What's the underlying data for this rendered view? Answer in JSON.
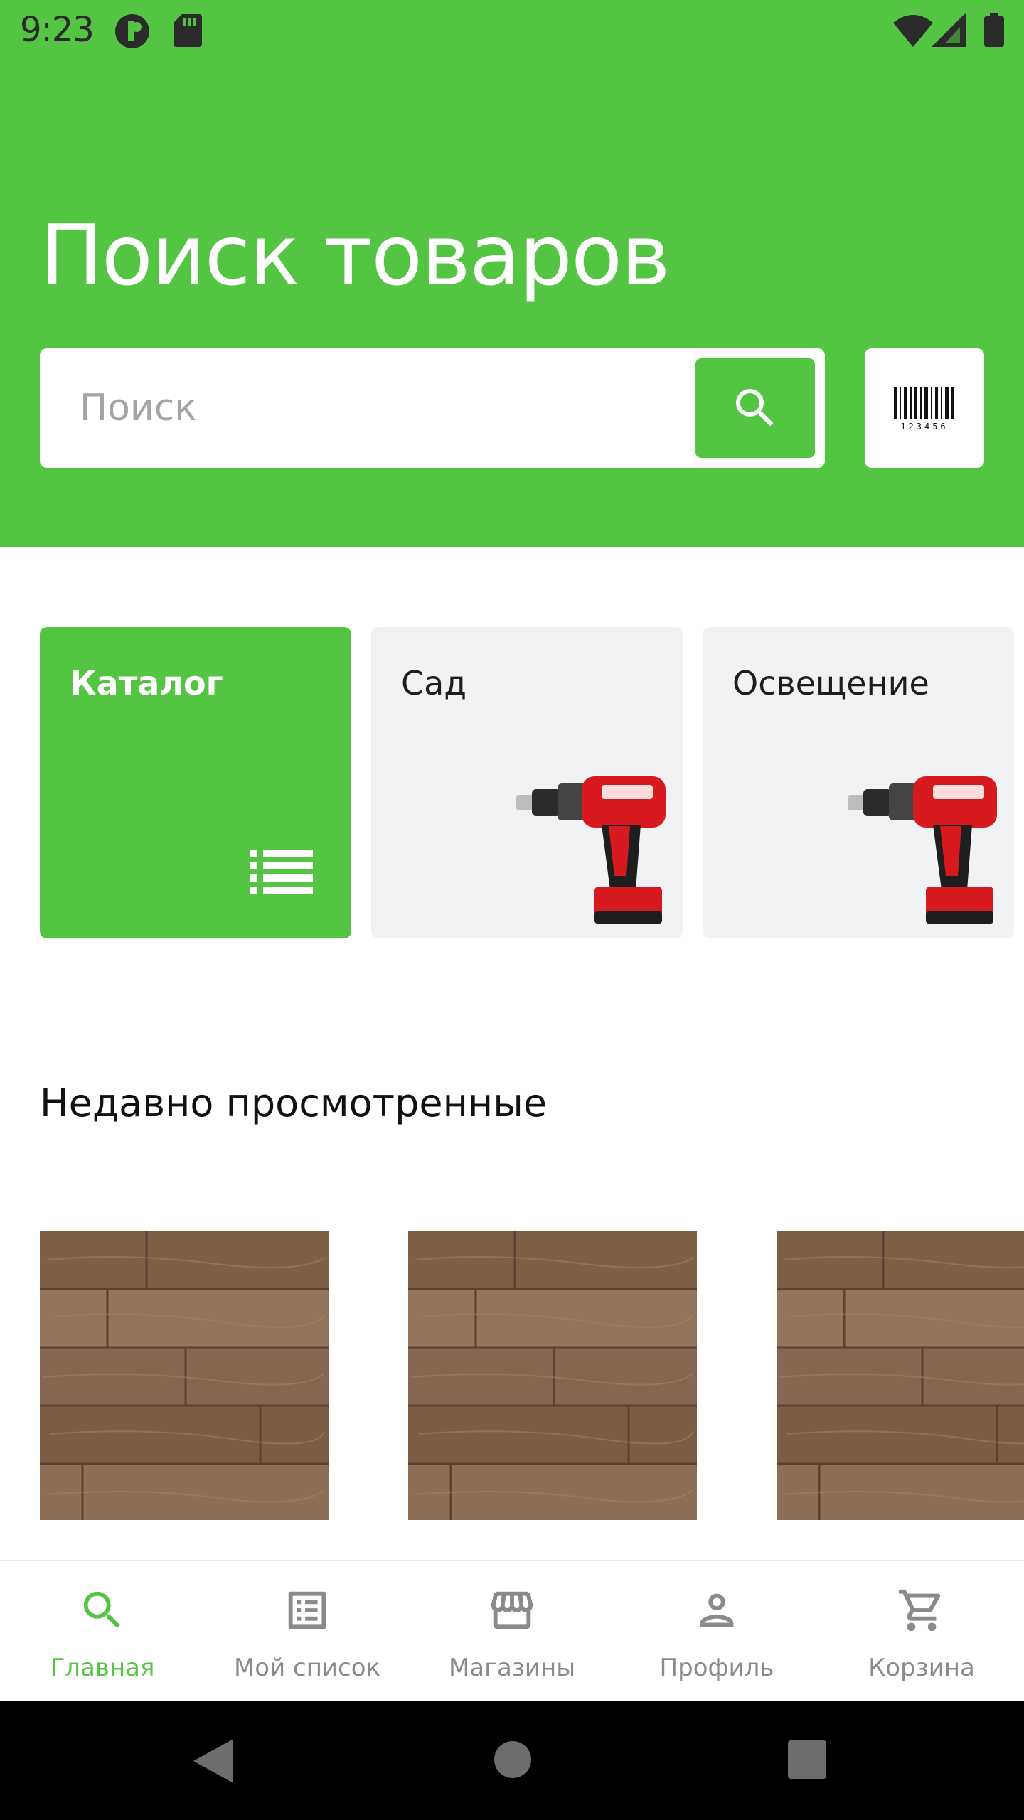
{
  "status_bar": {
    "time": "9:23",
    "icons": [
      "app-notification-icon",
      "sd-card-icon",
      "wifi-icon",
      "signal-icon",
      "battery-icon"
    ]
  },
  "header": {
    "title": "Поиск товаров",
    "background_color": "#54c443"
  },
  "search": {
    "placeholder": "Поиск",
    "value": "",
    "search_button_icon": "search-icon",
    "barcode_button_icon": "barcode-icon",
    "barcode_digits": "123456"
  },
  "categories": [
    {
      "label": "Каталог",
      "icon": "list-icon"
    },
    {
      "label": "Сад",
      "icon": "drill-image"
    },
    {
      "label": "Освещение",
      "icon": "drill-image"
    }
  ],
  "recent": {
    "title": "Недавно просмотренные",
    "items": [
      {
        "image": "wood-floor-image"
      },
      {
        "image": "wood-floor-image"
      },
      {
        "image": "wood-floor-image"
      }
    ]
  },
  "bottom_nav": {
    "items": [
      {
        "label": "Главная",
        "icon": "search-icon",
        "active": true
      },
      {
        "label": "Мой список",
        "icon": "list-icon",
        "active": false
      },
      {
        "label": "Магазины",
        "icon": "store-icon",
        "active": false
      },
      {
        "label": "Профиль",
        "icon": "person-icon",
        "active": false
      },
      {
        "label": "Корзина",
        "icon": "cart-icon",
        "active": false
      }
    ],
    "active_color": "#54c443",
    "inactive_color": "#8a8a8a"
  },
  "system_nav": [
    "back-icon",
    "home-icon",
    "recents-icon"
  ]
}
